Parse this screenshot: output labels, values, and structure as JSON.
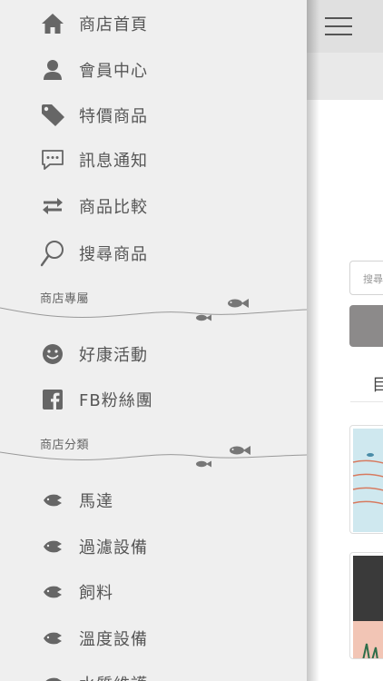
{
  "drawer": {
    "nav_items": [
      {
        "label": "商店首頁",
        "icon": "home-icon"
      },
      {
        "label": "會員中心",
        "icon": "user-icon"
      },
      {
        "label": "特價商品",
        "icon": "tag-icon"
      },
      {
        "label": "訊息通知",
        "icon": "chat-icon"
      },
      {
        "label": "商品比較",
        "icon": "compare-arrows-icon"
      },
      {
        "label": "搜尋商品",
        "icon": "search-icon"
      }
    ],
    "section_exclusive": {
      "title": "商店專屬",
      "items": [
        {
          "label": "好康活動",
          "icon": "smiley-icon"
        },
        {
          "label": "FB粉絲團",
          "icon": "facebook-icon"
        }
      ]
    },
    "section_category": {
      "title": "商店分類",
      "items": [
        {
          "label": "馬達",
          "icon": "fish-icon"
        },
        {
          "label": "過濾設備",
          "icon": "fish-icon"
        },
        {
          "label": "飼料",
          "icon": "fish-icon"
        },
        {
          "label": "溫度設備",
          "icon": "fish-icon"
        },
        {
          "label": "水質維護",
          "icon": "fish-icon"
        }
      ]
    }
  },
  "main": {
    "search_placeholder": "搜尋",
    "tab_label": "目"
  },
  "colors": {
    "drawer_bg": "#efefef",
    "text": "#565656",
    "icon": "#666666",
    "search_button": "#8c8a8a"
  }
}
